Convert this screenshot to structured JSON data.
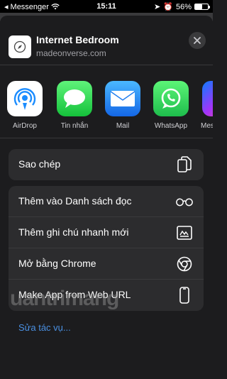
{
  "status_bar": {
    "carrier": "Messenger",
    "time": "15:11",
    "battery_percent_label": "56%",
    "battery_level": 0.56
  },
  "header": {
    "title": "Internet Bedroom",
    "subtitle": "madeonverse.com",
    "favicon_icon": "compass-icon",
    "close_icon": "close-icon"
  },
  "apps": [
    {
      "label": "AirDrop",
      "icon": "airdrop-icon",
      "color": "#ffffff"
    },
    {
      "label": "Tin nhắn",
      "icon": "messages-icon",
      "color": "#34c759"
    },
    {
      "label": "Mail",
      "icon": "mail-icon",
      "color": "#1f8ef1"
    },
    {
      "label": "WhatsApp",
      "icon": "whatsapp-icon",
      "color": "#25d366"
    },
    {
      "label": "Mes",
      "icon": "messenger-icon",
      "color": "#a334fa"
    }
  ],
  "actions_top": [
    {
      "label": "Sao chép",
      "icon": "copy-icon"
    }
  ],
  "actions_main": [
    {
      "label": "Thêm vào Danh sách đọc",
      "icon": "glasses-icon"
    },
    {
      "label": "Thêm ghi chú nhanh mới",
      "icon": "quick-note-icon"
    },
    {
      "label": "Mở bằng Chrome",
      "icon": "chrome-icon"
    },
    {
      "label": "Make App from Web URL",
      "icon": "phone-icon"
    }
  ],
  "edit_actions": "Sửa tác vụ...",
  "watermark": "uantrimang",
  "colors": {
    "link": "#4a90e2",
    "sheet": "#1c1c1e",
    "row": "#2c2c2e"
  }
}
